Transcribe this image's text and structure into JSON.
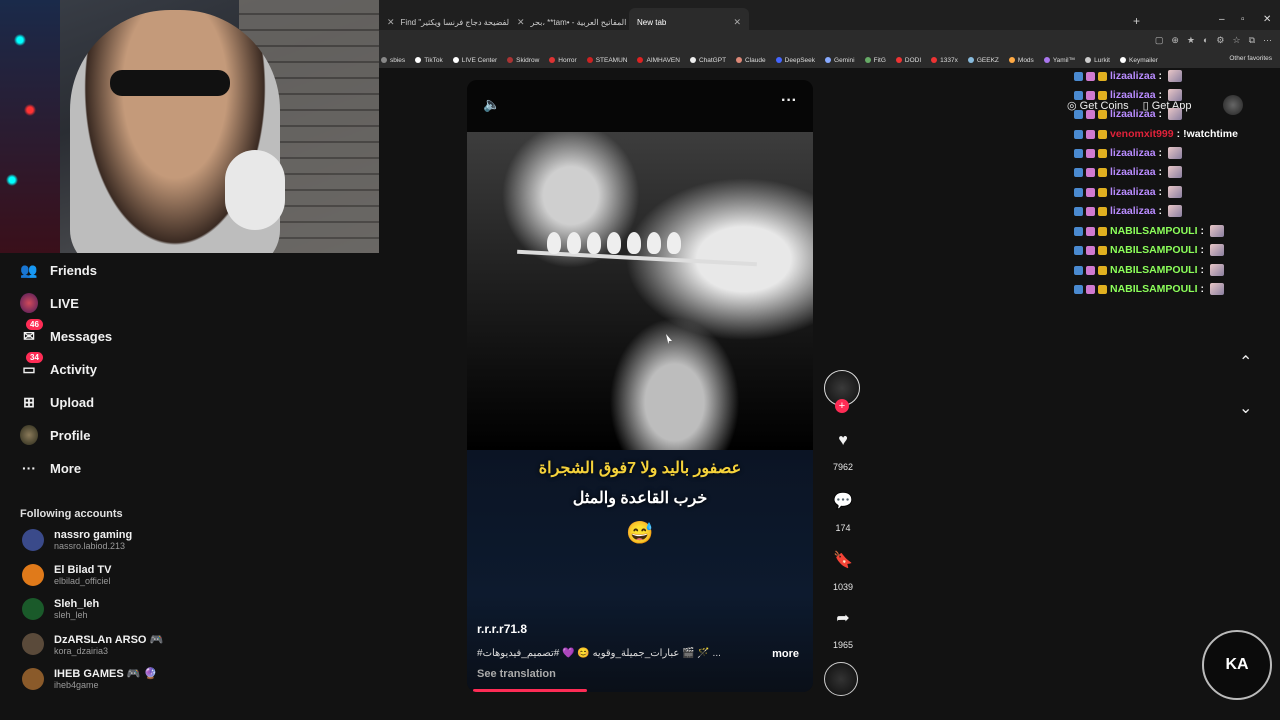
{
  "browser": {
    "tabs": [
      {
        "label": "Find \"لفضيحة دجاج فرنسا ويكثير\"",
        "active": false
      },
      {
        "label": "بحر، **tam• - لوحة المفاتيح العربية",
        "active": false
      },
      {
        "label": "New tab",
        "active": true
      }
    ],
    "new_tab_symbol": "+",
    "window_controls": [
      "–",
      "▫",
      "✕"
    ],
    "bookmarks": [
      {
        "label": "sbies",
        "color": "#888"
      },
      {
        "label": "TikTok",
        "color": "#fff"
      },
      {
        "label": "LIVE Center",
        "color": "#fff"
      },
      {
        "label": "Skidrow",
        "color": "#a33"
      },
      {
        "label": "Horror",
        "color": "#d33"
      },
      {
        "label": "STEAMUN",
        "color": "#c22"
      },
      {
        "label": "AIMHAVEN",
        "color": "#d22"
      },
      {
        "label": "ChatGPT",
        "color": "#eee"
      },
      {
        "label": "Claude",
        "color": "#d87"
      },
      {
        "label": "DeepSeek",
        "color": "#46f"
      },
      {
        "label": "Gemini",
        "color": "#8af"
      },
      {
        "label": "FitG",
        "color": "#6a6"
      },
      {
        "label": "DODI",
        "color": "#e33"
      },
      {
        "label": "1337x",
        "color": "#e33"
      },
      {
        "label": "GEEKZ",
        "color": "#8bd"
      },
      {
        "label": "Mods",
        "color": "#fa4"
      },
      {
        "label": "Yamil™",
        "color": "#a7e"
      },
      {
        "label": "Lurkit",
        "color": "#ccc"
      },
      {
        "label": "Keymailer",
        "color": "#fff"
      }
    ],
    "other_favorites": "Other favorites"
  },
  "sidebar": {
    "items": [
      {
        "label": "Friends",
        "icon": "friends-icon",
        "glyph": "👥",
        "badge": ""
      },
      {
        "label": "LIVE",
        "icon": "live-avatar",
        "glyph": "",
        "badge": ""
      },
      {
        "label": "Messages",
        "icon": "messages-icon",
        "glyph": "✉",
        "badge": "46"
      },
      {
        "label": "Activity",
        "icon": "activity-icon",
        "glyph": "▭",
        "badge": "34"
      },
      {
        "label": "Upload",
        "icon": "upload-icon",
        "glyph": "⊞",
        "badge": ""
      },
      {
        "label": "Profile",
        "icon": "profile-icon",
        "glyph": "",
        "badge": ""
      },
      {
        "label": "More",
        "icon": "more-icon",
        "glyph": "···",
        "badge": ""
      }
    ],
    "following_title": "Following accounts",
    "accounts": [
      {
        "name": "nassro gaming",
        "handle": "nassro.labiod.213",
        "color": "#3a4a8a"
      },
      {
        "name": "El Bilad TV",
        "handle": "elbilad_officiel",
        "color": "#e07a1a"
      },
      {
        "name": "Sleh_leh",
        "handle": "sleh_leh",
        "color": "#1a5a2a"
      },
      {
        "name": "DzARSLAn ARSO 🎮",
        "handle": "kora_dzairia3",
        "color": "#5a4a3a"
      },
      {
        "name": "IHEB GAMES 🎮 🔮",
        "handle": "iheb4game",
        "color": "#8a5a2a"
      }
    ]
  },
  "video": {
    "mute_icon": "🔈",
    "menu_icon": "···",
    "caption_line1": "عصفور باليد ولا 7فوق الشجراة",
    "caption_line2": "خرب القاعدة والمثل",
    "caption_emoji": "😅",
    "author": "r.r.r.r71.8",
    "description": "#عبارات_جميلة_وقويه 😊 💜 #تصميم_فيديوهات 🎬 🪄 ...",
    "more_label": "more",
    "see_translation": "See translation",
    "progress": 0.33
  },
  "actions": {
    "like_count": "7962",
    "comment_count": "174",
    "bookmark_count": "1039",
    "share_count": "1965",
    "like_icon": "♥",
    "comment_icon": "💬",
    "bookmark_icon": "🔖",
    "share_icon": "➦",
    "follow_plus": "+"
  },
  "navigation": {
    "up": "⌃",
    "down": "⌄"
  },
  "topbar": {
    "get_coins": "Get Coins",
    "get_app": "Get App"
  },
  "chat": [
    {
      "user": "lizaalizaa",
      "color": "#b98cff",
      "sep": " :",
      "msg": ""
    },
    {
      "user": "lizaalizaa",
      "color": "#b98cff",
      "sep": " :",
      "msg": ""
    },
    {
      "user": "lizaalizaa",
      "color": "#b98cff",
      "sep": " :",
      "msg": ""
    },
    {
      "user": "venomxit999",
      "color": "#e0223a",
      "sep": " :",
      "msg": " !watchtime"
    },
    {
      "user": "lizaalizaa",
      "color": "#b98cff",
      "sep": " :",
      "msg": ""
    },
    {
      "user": "lizaalizaa",
      "color": "#b98cff",
      "sep": " :",
      "msg": ""
    },
    {
      "user": "lizaalizaa",
      "color": "#b98cff",
      "sep": " :",
      "msg": ""
    },
    {
      "user": "lizaalizaa",
      "color": "#b98cff",
      "sep": " :",
      "msg": ""
    },
    {
      "user": "NABILSAMPOULI",
      "color": "#8cff5a",
      "sep": " :",
      "msg": ""
    },
    {
      "user": "NABILSAMPOULI",
      "color": "#8cff5a",
      "sep": " :",
      "msg": ""
    },
    {
      "user": "NABILSAMPOULI",
      "color": "#8cff5a",
      "sep": " :",
      "msg": ""
    },
    {
      "user": "NABILSAMPOULI",
      "color": "#8cff5a",
      "sep": " :",
      "msg": ""
    }
  ],
  "logo_text": "KA"
}
